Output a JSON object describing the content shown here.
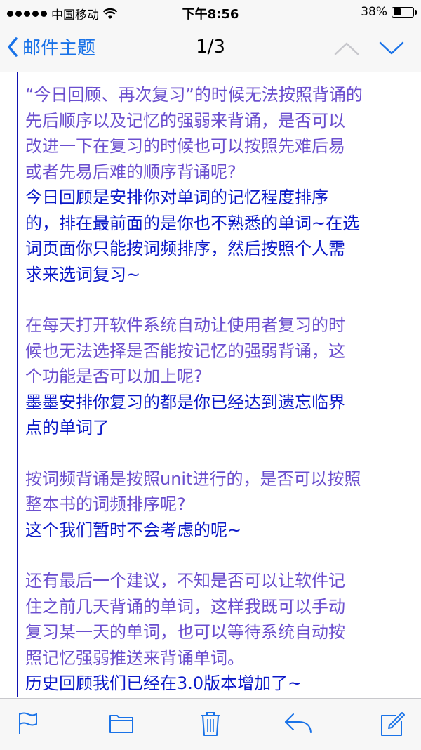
{
  "status_bar": {
    "carrier": "中国移动",
    "time": "下午8:56",
    "battery_percent": "38%",
    "battery_level": 0.38
  },
  "nav": {
    "back_label": "邮件主题",
    "pager": "1/3"
  },
  "message": {
    "blocks": [
      {
        "question": [
          "“今日回顾、再次复习”的时候无法按照背诵的",
          "先后顺序以及记忆的强弱来背诵，是否可以",
          "改进一下在复习的时候也可以按照先难后易",
          "或者先易后难的顺序背诵呢?"
        ],
        "answer": [
          "今日回顾是安排你对单词的记忆程度排序",
          "的，排在最前面的是你也不熟悉的单词~在选",
          "词页面你只能按词频排序，然后按照个人需",
          "求来选词复习~"
        ]
      },
      {
        "question": [
          "在每天打开软件系统自动让使用者复习的时",
          "候也无法选择是否能按记忆的强弱背诵，这",
          "个功能是否可以加上呢?"
        ],
        "answer": [
          "墨墨安排你复习的都是你已经达到遗忘临界",
          "点的单词了"
        ]
      },
      {
        "question": [
          "按词频背诵是按照unit进行的，是否可以按照",
          "整本书的词频排序呢?"
        ],
        "answer": [
          "这个我们暂时不会考虑的呢~"
        ]
      },
      {
        "question": [
          "还有最后一个建议，不知是否可以让软件记",
          "住之前几天背诵的单词，这样我既可以手动",
          "复习某一天的单词，也可以等待系统自动按",
          "照记忆强弱推送来背诵单词。"
        ],
        "answer": [
          "历史回顾我们已经在3.0版本增加了~"
        ]
      }
    ]
  },
  "colors": {
    "accent": "#1a73e8",
    "question_text": "#6b4fcf",
    "answer_text": "#0b18c8",
    "quote_bar": "#1010b0"
  },
  "toolbar_icons": [
    "flag-icon",
    "folder-icon",
    "trash-icon",
    "reply-icon",
    "compose-icon"
  ]
}
